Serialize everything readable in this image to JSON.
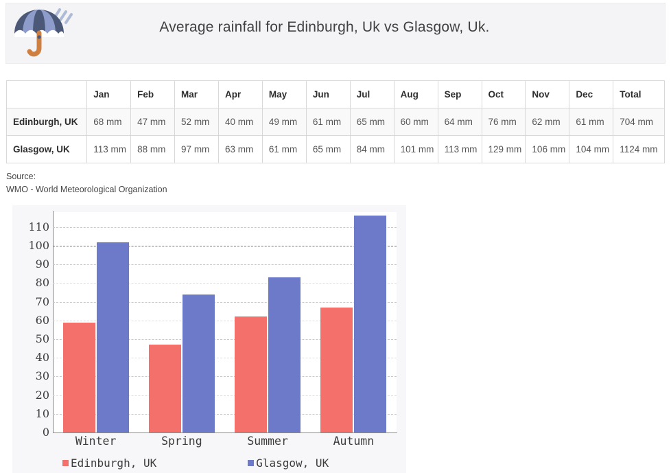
{
  "header": {
    "title": "Average rainfall for Edinburgh, Uk vs Glasgow, Uk.",
    "icon": "umbrella-with-rain-icon"
  },
  "table": {
    "corner_label": "",
    "columns": [
      "Jan",
      "Feb",
      "Mar",
      "Apr",
      "May",
      "Jun",
      "Jul",
      "Aug",
      "Sep",
      "Oct",
      "Nov",
      "Dec",
      "Total"
    ],
    "rows": [
      {
        "city": "Edinburgh, UK",
        "values": [
          "68 mm",
          "47 mm",
          "52 mm",
          "40 mm",
          "49 mm",
          "61 mm",
          "65 mm",
          "60 mm",
          "64 mm",
          "76 mm",
          "62 mm",
          "61 mm",
          "704 mm"
        ]
      },
      {
        "city": "Glasgow, UK",
        "values": [
          "113 mm",
          "88 mm",
          "97 mm",
          "63 mm",
          "61 mm",
          "65 mm",
          "84 mm",
          "101 mm",
          "113 mm",
          "129 mm",
          "106 mm",
          "104 mm",
          "1124 mm"
        ]
      }
    ]
  },
  "source": {
    "label": "Source:",
    "text": "WMO - World Meteorological Organization"
  },
  "colors": {
    "edinburgh": "#f4706a",
    "glasgow": "#6d79c9",
    "banner_background": "#f4f4f6",
    "chart_background": "#f7f7f9",
    "plot_background": "#ffffff",
    "gridline": "#c9c9c9",
    "gridline_major": "#6e6e6e",
    "axis": "#8a8a8a"
  },
  "chart_data": {
    "type": "bar",
    "title": "",
    "xlabel": "",
    "ylabel": "",
    "categories": [
      "Winter",
      "Spring",
      "Summer",
      "Autumn"
    ],
    "series": [
      {
        "name": "Edinburgh, UK",
        "color": "#f4706a",
        "values": [
          59,
          47,
          62,
          67
        ]
      },
      {
        "name": "Glasgow, UK",
        "color": "#6d79c9",
        "values": [
          102,
          74,
          83,
          116
        ]
      }
    ],
    "ylim": [
      0,
      118
    ],
    "yticks": [
      0,
      10,
      20,
      30,
      40,
      50,
      60,
      70,
      80,
      90,
      100,
      110
    ],
    "ytick_labels": [
      "0",
      "10",
      "20",
      "30",
      "40",
      "50",
      "60",
      "70",
      "80",
      "90",
      "100",
      "110"
    ],
    "grid": true,
    "legend_position": "bottom"
  }
}
